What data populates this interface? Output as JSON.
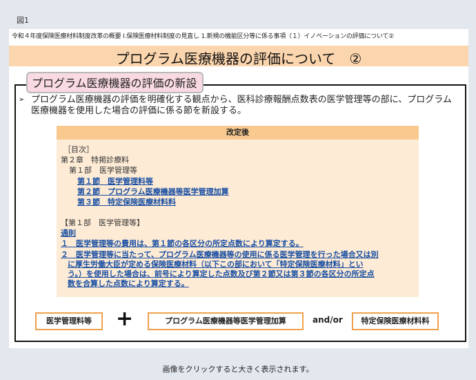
{
  "figure_label": "図1",
  "breadcrumb": "令和４年度保険医療材料制度改革の概要 Ⅰ.保険医療材料制度の見直し 1.新規の機能区分等に係る事項（１）イノベーションの評価について②",
  "title": "プログラム医療機器の評価について　②",
  "section_tag": "プログラム医療機器の評価の新設",
  "bullet": {
    "mark": "➢",
    "text": "プログラム医療機器の評価を明確化する観点から、医科診療報酬点数表の医学管理等の部に、プログラム医療機器を使用した場合の評価に係る節を新設する。"
  },
  "revision": {
    "header": "改定後",
    "toc_heading": "［目次］",
    "chapter": "第２章　特掲診療料",
    "part": "第１部　医学管理等",
    "sections": [
      "第１節　医学管理料等",
      "第２節　プログラム医療機器等医学管理加算",
      "第３節　特定保険医療材料料"
    ],
    "part_bracket": "【第１部　医学管理等】",
    "general_rules": "通則",
    "rule1": "１　医学管理等の費用は、第１節の各区分の所定点数により算定する。",
    "rule2_lines": [
      "２　医学管理等に当たって、プログラム医療機器等の使用に係る医学管理を行った場合又は別",
      "に厚生労働大臣が定める保険医療材料（以下この部において「特定保険医療材料」とい",
      "う。）を使用した場合は、前号により算定した点数及び第２節又は第３節の各区分の所定点",
      "数を合算した点数により算定する。"
    ]
  },
  "formula": {
    "box1": "医学管理料等",
    "plus": "+",
    "box2": "プログラム医療機器等医学管理加算",
    "andor": "and/or",
    "box3": "特定保険医療材料料"
  },
  "caption": "画像をクリックすると大きく表示されます。"
}
